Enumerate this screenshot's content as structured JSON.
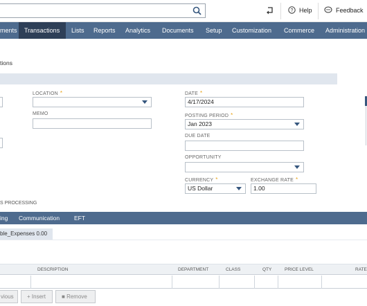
{
  "header": {
    "help_label": "Help",
    "feedback_label": "Feedback"
  },
  "nav": {
    "items": [
      {
        "label": "ments"
      },
      {
        "label": "Transactions",
        "active": true
      },
      {
        "label": "Lists"
      },
      {
        "label": "Reports"
      },
      {
        "label": "Analytics"
      },
      {
        "label": "Documents"
      },
      {
        "label": "Setup"
      },
      {
        "label": "Customization"
      },
      {
        "label": "Commerce"
      },
      {
        "label": "Administration"
      }
    ]
  },
  "page": {
    "title": "tions"
  },
  "form": {
    "location_label": "LOCATION",
    "location_value": "",
    "memo_label": "MEMO",
    "memo_value": "",
    "date_label": "DATE",
    "date_value": "4/17/2024",
    "posting_period_label": "POSTING PERIOD",
    "posting_period_value": "Jan 2023",
    "due_date_label": "DUE DATE",
    "due_date_value": "",
    "opportunity_label": "OPPORTUNITY",
    "opportunity_value": "",
    "currency_label": "CURRENCY",
    "currency_value": "US Dollar",
    "exchange_rate_label": "EXCHANGE RATE",
    "exchange_rate_value": "1.00"
  },
  "processing_label": "S PROCESSING",
  "subtabs": [
    {
      "label": "ing"
    },
    {
      "label": "Communication"
    },
    {
      "label": "EFT"
    }
  ],
  "expenses_summary": "ble_Expenses 0.00",
  "grid": {
    "columns": [
      "DESCRIPTION",
      "DEPARTMENT",
      "CLASS",
      "QTY",
      "PRICE LEVEL",
      "RATE"
    ]
  },
  "buttons": {
    "previous_label": "vious",
    "insert_label": "Insert",
    "remove_label": "Remove"
  },
  "colors": {
    "nav_bg": "#4e6b8e",
    "nav_active": "#2e3f57",
    "required": "#e8a317"
  }
}
